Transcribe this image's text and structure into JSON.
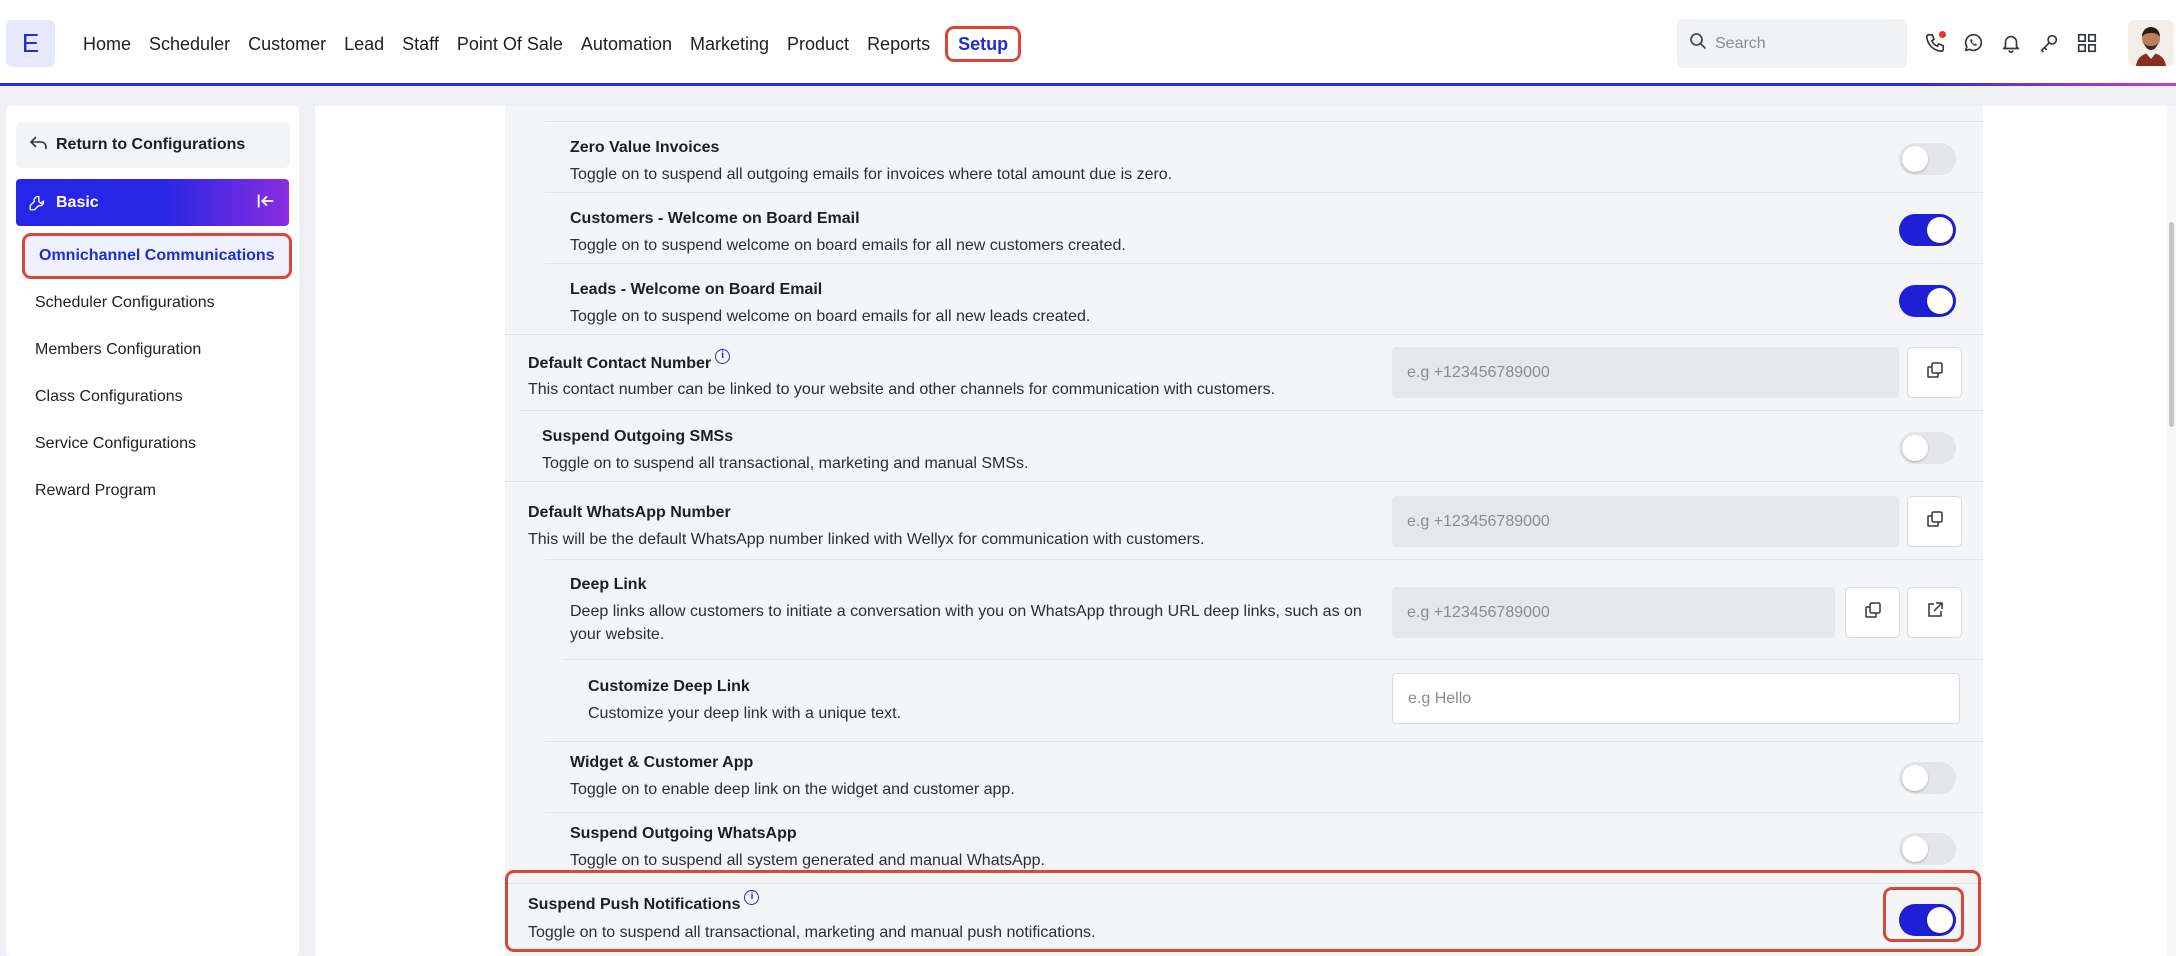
{
  "header": {
    "logo": "E",
    "nav": [
      "Home",
      "Scheduler",
      "Customer",
      "Lead",
      "Staff",
      "Point Of Sale",
      "Automation",
      "Marketing",
      "Product",
      "Reports",
      "Setup"
    ],
    "active_nav": "Setup",
    "search_placeholder": "Search",
    "icons": [
      "phone-call-icon",
      "whatsapp-icon",
      "bell-icon",
      "key-icon",
      "apps-grid-icon"
    ]
  },
  "sidebar": {
    "return_label": "Return to Configurations",
    "section_label": "Basic",
    "items": [
      "Omnichannel Communications",
      "Scheduler Configurations",
      "Members Configuration",
      "Class Configurations",
      "Service Configurations",
      "Reward Program"
    ],
    "active_item": "Omnichannel Communications"
  },
  "settings": {
    "zero_value": {
      "title": "Zero Value Invoices",
      "desc": "Toggle on to suspend all outgoing emails for invoices where total amount due is zero.",
      "on": false
    },
    "customers_welcome": {
      "title": "Customers - Welcome on Board Email",
      "desc": "Toggle on to suspend welcome on board emails for all new customers created.",
      "on": true
    },
    "leads_welcome": {
      "title": "Leads - Welcome on Board Email",
      "desc": "Toggle on to suspend welcome on board emails for all new leads created.",
      "on": true
    },
    "default_contact": {
      "title": "Default Contact Number",
      "desc": "This contact number can be linked to your website and other channels for communication with customers.",
      "placeholder": "e.g +123456789000"
    },
    "suspend_sms": {
      "title": "Suspend Outgoing SMSs",
      "desc": "Toggle on to suspend all transactional, marketing and manual SMSs.",
      "on": false
    },
    "default_whatsapp": {
      "title": "Default WhatsApp Number",
      "desc": "This will be the default WhatsApp number linked with Wellyx for communication with customers.",
      "placeholder": "e.g +123456789000"
    },
    "deep_link": {
      "title": "Deep Link",
      "desc": "Deep links allow customers to initiate a conversation with you on WhatsApp through URL deep links, such as on your website.",
      "placeholder": "e.g +123456789000"
    },
    "customize_deep_link": {
      "title": "Customize Deep Link",
      "desc": "Customize your deep link with a unique text.",
      "placeholder": "e.g Hello"
    },
    "widget_app": {
      "title": "Widget & Customer App",
      "desc": "Toggle on to enable deep link on the widget and customer app.",
      "on": false
    },
    "suspend_whatsapp": {
      "title": "Suspend Outgoing WhatsApp",
      "desc": "Toggle on to suspend all system generated and manual WhatsApp.",
      "on": false
    },
    "suspend_push": {
      "title": "Suspend Push Notifications",
      "desc": "Toggle on to suspend all transactional, marketing and manual push notifications.",
      "on": true
    }
  },
  "colors": {
    "accent": "#1f1fd8",
    "highlight": "#d9463a",
    "toggle_off": "#e4e5e8"
  }
}
